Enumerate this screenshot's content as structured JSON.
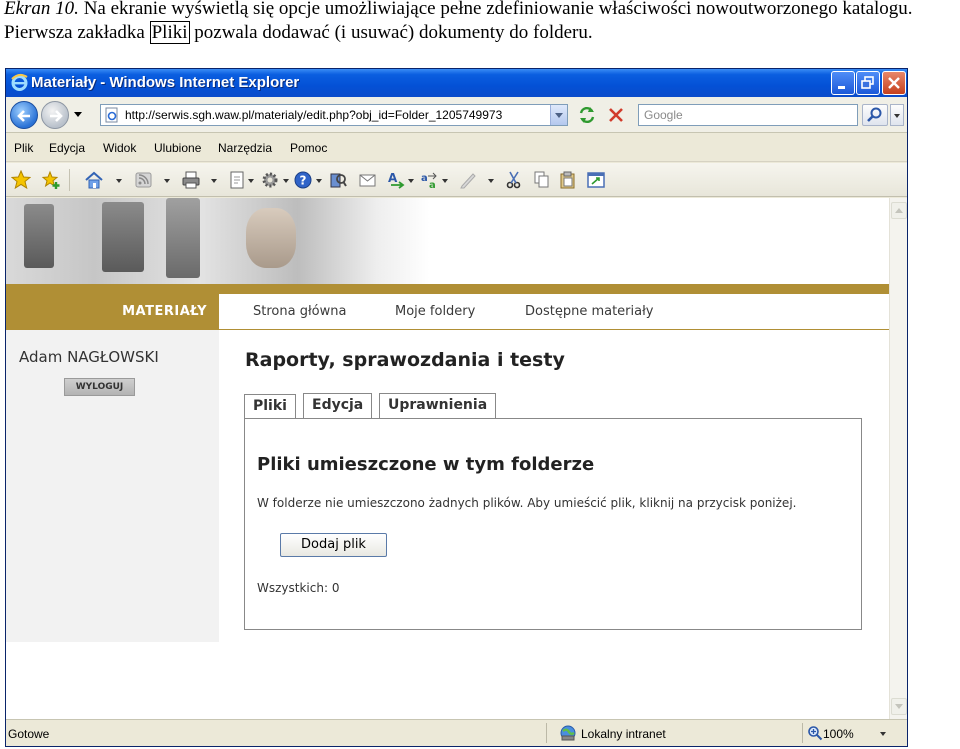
{
  "caption": {
    "line1_prefix": "Ekran 10.",
    "line1_text": " Na ekranie wyświetlą się opcje umożliwiające pełne zdefiniowanie właściwości nowoutworzonego katalogu.",
    "line2_before": "Pierwsza zakładka ",
    "line2_boxed": "Pliki",
    "line2_after": " pozwala dodawać (i usuwać) dokumenty do folderu."
  },
  "window": {
    "title": "Materiały - Windows Internet Explorer",
    "address": "http://serwis.sgh.waw.pl/materialy/edit.php?obj_id=Folder_1205749973",
    "search_placeholder": "Google"
  },
  "menu": [
    "Plik",
    "Edycja",
    "Widok",
    "Ulubione",
    "Narzędzia",
    "Pomoc"
  ],
  "site": {
    "brand": "MATERIAŁY",
    "nav": [
      "Strona główna",
      "Moje foldery",
      "Dostępne materiały"
    ],
    "user": "Adam NAGŁOWSKI",
    "logout": "WYLOGUJ",
    "heading": "Raporty, sprawozdania i testy",
    "tabs": [
      "Pliki",
      "Edycja",
      "Uprawnienia"
    ],
    "panel_title": "Pliki umieszczone w tym folderze",
    "message": "W folderze nie umieszczono żadnych plików. Aby umieścić plik, kliknij na przycisk poniżej.",
    "add_button": "Dodaj plik",
    "count": "Wszystkich: 0"
  },
  "status": {
    "text": "Gotowe",
    "zone": "Lokalny intranet",
    "zoom": "100%"
  },
  "colors": {
    "brand_gold": "#b08f35",
    "xp_title_blue": "#0451d6"
  }
}
